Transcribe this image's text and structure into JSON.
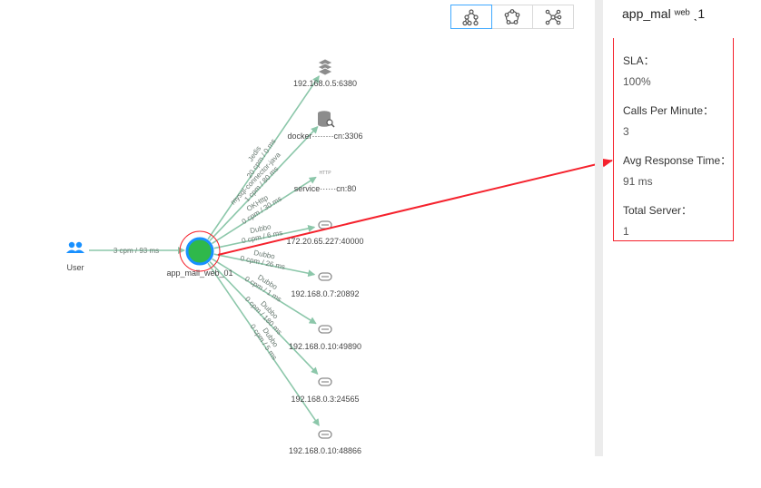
{
  "toolbar": {
    "buttons": [
      {
        "icon": "topology-tree-icon",
        "active": true
      },
      {
        "icon": "topology-circle-icon",
        "active": false
      },
      {
        "icon": "topology-radial-icon",
        "active": false
      }
    ]
  },
  "panel": {
    "title": "app_mal  ʷᵉᵇ  ˎ1",
    "sla_label": "SLA：",
    "sla_value": "100%",
    "cpm_label": "Calls Per Minute：",
    "cpm_value": "3",
    "art_label": "Avg Response Time：",
    "art_value": "91 ms",
    "servers_label": "Total Server：",
    "servers_value": "1"
  },
  "graph": {
    "user": {
      "label": "User"
    },
    "center": {
      "label": "app_mall_web_01"
    },
    "user_edge_label": "3 cpm / 93 ms",
    "colors": {
      "edge": "#8cc7aa",
      "center_fill": "#2fb84b",
      "center_ring": "#1890ff",
      "highlight": "#f5222d",
      "user": "#1890ff",
      "icon": "#8c8c8c"
    },
    "targets": [
      {
        "label": "192.168.0.5:6380",
        "icon": "redis-icon",
        "edge_label": [
          "Jedis",
          "20 cpm / 0 ms"
        ]
      },
      {
        "label": "docker········cn:3306",
        "icon": "database-icon",
        "edge_label": [
          "mysql-connector-java",
          "1 cpm / 80 ms"
        ]
      },
      {
        "label": "service······cn:80",
        "icon": "http-icon",
        "edge_label": [
          "OKHttp",
          "0 cpm / 30 ms"
        ]
      },
      {
        "label": "172.20.65.227:40000",
        "icon": "rpc-icon",
        "edge_label": [
          "Dubbo",
          "0 cpm / 6 ms"
        ]
      },
      {
        "label": "192.168.0.7:20892",
        "icon": "rpc-icon",
        "edge_label": [
          "Dubbo",
          "0 cpm / 26 ms"
        ]
      },
      {
        "label": "192.168.0.10:49890",
        "icon": "rpc-icon",
        "edge_label": [
          "Dubbo",
          "0 cpm / 1 ms"
        ]
      },
      {
        "label": "192.168.0.3:24565",
        "icon": "rpc-icon",
        "edge_label": [
          "Dubbo",
          "0 cpm / 180 ms"
        ]
      },
      {
        "label": "192.168.0.10:48866",
        "icon": "rpc-icon",
        "edge_label": [
          "Dubbo",
          "0 cpm / 5 ms"
        ]
      }
    ]
  }
}
